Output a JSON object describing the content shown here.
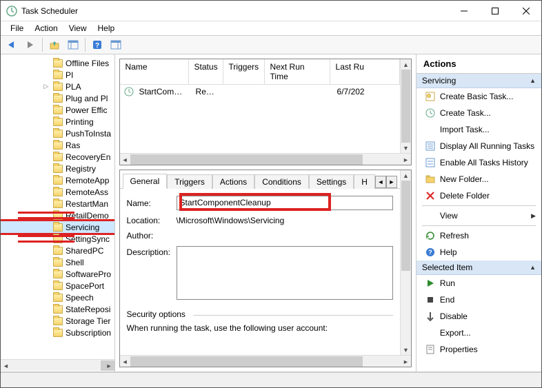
{
  "window": {
    "title": "Task Scheduler"
  },
  "menus": {
    "file": "File",
    "action": "Action",
    "view": "View",
    "help": "Help"
  },
  "tree": {
    "items": [
      {
        "label": "Offline Files",
        "indent": 1
      },
      {
        "label": "PI",
        "indent": 1
      },
      {
        "label": "PLA",
        "indent": 1,
        "expandable": true
      },
      {
        "label": "Plug and Pl",
        "indent": 1
      },
      {
        "label": "Power Effic",
        "indent": 1
      },
      {
        "label": "Printing",
        "indent": 1
      },
      {
        "label": "PushToInsta",
        "indent": 1
      },
      {
        "label": "Ras",
        "indent": 1
      },
      {
        "label": "RecoveryEn",
        "indent": 1
      },
      {
        "label": "Registry",
        "indent": 1
      },
      {
        "label": "RemoteApp",
        "indent": 1
      },
      {
        "label": "RemoteAss",
        "indent": 1
      },
      {
        "label": "RestartMan",
        "indent": 1
      },
      {
        "label": "RetailDemo",
        "indent": 1,
        "crossed": true
      },
      {
        "label": "Servicing",
        "indent": 1,
        "selected": true,
        "highlight": true
      },
      {
        "label": "SettingSync",
        "indent": 1,
        "crossed": true
      },
      {
        "label": "SharedPC",
        "indent": 1
      },
      {
        "label": "Shell",
        "indent": 1
      },
      {
        "label": "SoftwarePro",
        "indent": 1
      },
      {
        "label": "SpacePort",
        "indent": 1
      },
      {
        "label": "Speech",
        "indent": 1
      },
      {
        "label": "StateReposi",
        "indent": 1
      },
      {
        "label": "Storage Tier",
        "indent": 1
      },
      {
        "label": "Subscription",
        "indent": 1
      }
    ]
  },
  "list": {
    "columns": {
      "name": "Name",
      "status": "Status",
      "triggers": "Triggers",
      "next_run": "Next Run Time",
      "last_run": "Last Ru"
    },
    "rows": [
      {
        "name": "StartCompo...",
        "status": "Ready",
        "triggers": "",
        "next_run": "",
        "last_run": "6/7/202"
      }
    ]
  },
  "details": {
    "tabs": {
      "general": "General",
      "triggers": "Triggers",
      "actions": "Actions",
      "conditions": "Conditions",
      "settings": "Settings",
      "history": "H"
    },
    "labels": {
      "name": "Name:",
      "location": "Location:",
      "author": "Author:",
      "description": "Description:",
      "security": "Security options",
      "account_line": "When running the task, use the following user account:"
    },
    "values": {
      "name": "StartComponentCleanup",
      "location": "\\Microsoft\\Windows\\Servicing",
      "author": ""
    }
  },
  "actions": {
    "header": "Actions",
    "group1_title": "Servicing",
    "group1": {
      "create_basic": "Create Basic Task...",
      "create_task": "Create Task...",
      "import": "Import Task...",
      "display_running": "Display All Running Tasks",
      "enable_history": "Enable All Tasks History",
      "new_folder": "New Folder...",
      "delete_folder": "Delete Folder",
      "view": "View",
      "refresh": "Refresh",
      "help": "Help"
    },
    "group2_title": "Selected Item",
    "group2": {
      "run": "Run",
      "end": "End",
      "disable": "Disable",
      "export": "Export...",
      "properties": "Properties"
    }
  }
}
